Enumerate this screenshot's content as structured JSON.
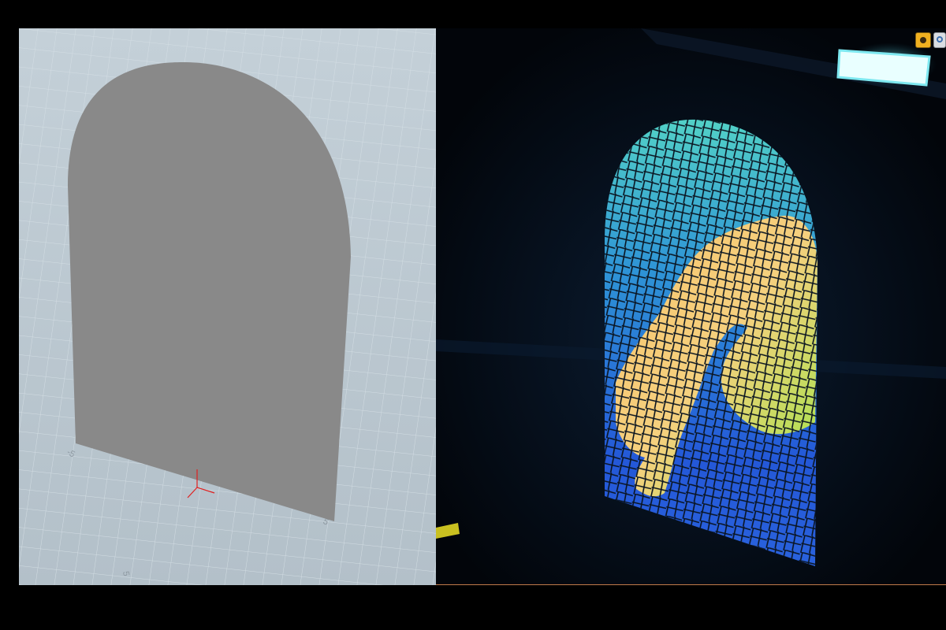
{
  "left_viewport": {
    "label": "geometry-view",
    "grid_labels": [
      "-5",
      "5",
      "5"
    ],
    "plane_color": "#8a8a8a",
    "grid_color": "#b9c6cf",
    "axis_colors": {
      "x": "#e02020",
      "y": "#e02020",
      "z": "#e02020"
    }
  },
  "right_viewport": {
    "label": "render-view",
    "stained_glass_colors": [
      "#4fd4c8",
      "#2c8ad8",
      "#1f4ed8",
      "#f5c872",
      "#9ee64a",
      "#3b6de0"
    ],
    "light_color": "#e9ffff"
  },
  "toolbar": {
    "icons": [
      "camera-handle-icon",
      "search-icon"
    ]
  }
}
